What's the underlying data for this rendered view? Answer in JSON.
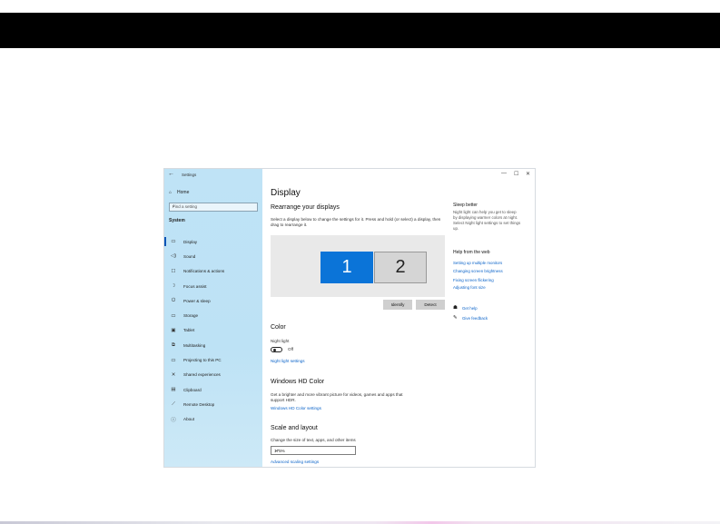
{
  "window": {
    "title": "Settings",
    "back_icon": "back-arrow-icon",
    "controls": [
      "—",
      "☐",
      "✕"
    ]
  },
  "sidebar": {
    "home": "Home",
    "search_placeholder": "Find a setting",
    "section": "System",
    "items": [
      {
        "label": "Display",
        "icon": "monitor-icon",
        "glyph": "▭",
        "selected": true
      },
      {
        "label": "Sound",
        "icon": "speaker-icon",
        "glyph": "◁)"
      },
      {
        "label": "Notifications & actions",
        "icon": "notification-icon",
        "glyph": "☐"
      },
      {
        "label": "Focus assist",
        "icon": "moon-icon",
        "glyph": "☽"
      },
      {
        "label": "Power & sleep",
        "icon": "power-icon",
        "glyph": "⏻"
      },
      {
        "label": "Storage",
        "icon": "storage-icon",
        "glyph": "▭"
      },
      {
        "label": "Tablet",
        "icon": "tablet-icon",
        "glyph": "▣"
      },
      {
        "label": "Multitasking",
        "icon": "multitasking-icon",
        "glyph": "⧉"
      },
      {
        "label": "Projecting to this PC",
        "icon": "projecting-icon",
        "glyph": "▭"
      },
      {
        "label": "Shared experiences",
        "icon": "shared-icon",
        "glyph": "✕"
      },
      {
        "label": "Clipboard",
        "icon": "clipboard-icon",
        "glyph": "▤"
      },
      {
        "label": "Remote Desktop",
        "icon": "remote-icon",
        "glyph": "⟋"
      },
      {
        "label": "About",
        "icon": "info-icon",
        "glyph": "ⓘ"
      }
    ]
  },
  "main": {
    "title": "Display",
    "rearrange": {
      "heading": "Rearrange your displays",
      "desc1": "Select a display below to change the settings for it. Press and hold (or select) a display, then",
      "desc2": "drag to rearrange it.",
      "monitor1": "1",
      "monitor2": "2",
      "identify": "Identify",
      "detect": "Detect"
    },
    "color": {
      "heading": "Color",
      "night_light_label": "Night light",
      "toggle_state": "Off",
      "settings_link": "Night light settings"
    },
    "hd": {
      "heading": "Windows HD Color",
      "desc1": "Get a brighter and more vibrant picture for videos, games and apps that",
      "desc2": "support HDR.",
      "settings_link": "Windows HD Color settings"
    },
    "scale": {
      "heading": "Scale and layout",
      "desc": "Change the size of text, apps, and other items",
      "value": "175%",
      "advanced_link": "Advanced scaling settings"
    }
  },
  "right": {
    "sleep_heading": "Sleep better",
    "sleep_text": [
      "Night light can help you get to sleep",
      "by displaying warmer colors at night.",
      "Select Night light settings to set things",
      "up."
    ],
    "help_heading": "Help from the web",
    "help_links": [
      "Setting up multiple monitors",
      "Changing screen brightness",
      "Fixing screen flickering",
      "Adjusting font size"
    ],
    "get_help": "Get help",
    "feedback": "Give feedback"
  }
}
